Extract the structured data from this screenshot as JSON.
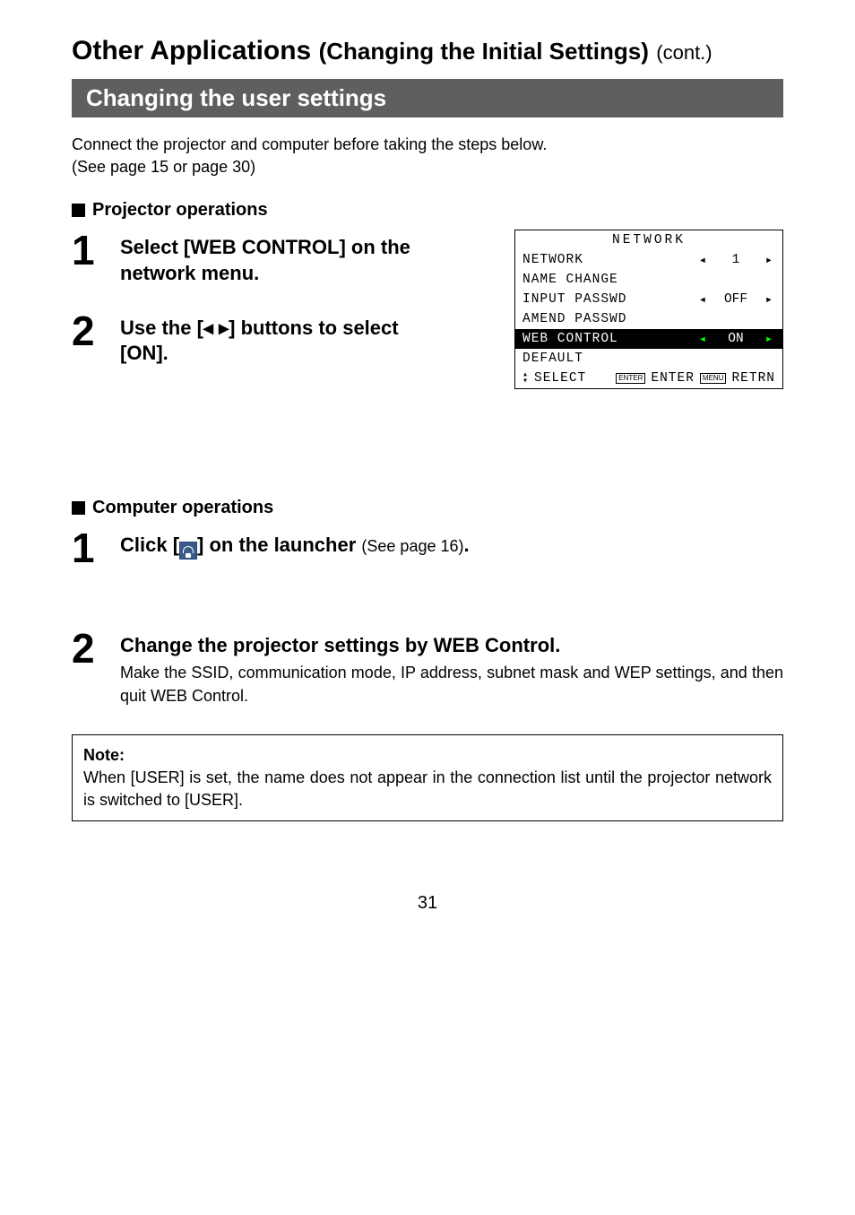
{
  "header": {
    "title_primary": "Other Applications",
    "title_secondary": "(Changing the Initial Settings)",
    "title_suffix": "(cont.)",
    "section_title": "Changing the user settings"
  },
  "intro": {
    "line1": "Connect the projector and computer before taking the steps below.",
    "line2": "(See page 15 or page 30)"
  },
  "projector": {
    "heading": "Projector operations",
    "steps": [
      {
        "num": "1",
        "title_a": "Select [WEB CONTROL] on the",
        "title_b": "network menu."
      },
      {
        "num": "2",
        "title_a": "Use the [",
        "title_b": "] buttons to select",
        "title_c": "[ON]."
      }
    ]
  },
  "menu": {
    "title": "NETWORK",
    "rows": [
      {
        "label": "NETWORK",
        "left_arrow": true,
        "value": "1",
        "right_arrow": true
      },
      {
        "label": "NAME CHANGE"
      },
      {
        "label": "INPUT PASSWD",
        "left_arrow": true,
        "value": "OFF",
        "right_arrow": true
      },
      {
        "label": "AMEND PASSWD"
      },
      {
        "label": "WEB CONTROL",
        "left_arrow": true,
        "value": "ON",
        "right_arrow": true,
        "highlight": true
      },
      {
        "label": "DEFAULT"
      }
    ],
    "footer": {
      "select": "SELECT",
      "enter_badge": "ENTER",
      "enter": "ENTER",
      "menu_badge": "MENU",
      "retrn": "RETRN"
    }
  },
  "computer": {
    "heading": "Computer operations",
    "steps": [
      {
        "num": "1",
        "pre": "Click [",
        "post": "] on the launcher",
        "suffix": "(See page 16)",
        "period": "."
      },
      {
        "num": "2",
        "title": "Change the projector settings by WEB Control.",
        "body": "Make the SSID, communication mode, IP address, subnet mask and WEP settings, and then quit WEB Control."
      }
    ]
  },
  "note": {
    "title": "Note:",
    "body": "When [USER] is set, the name does not appear in the connection list until the projector network is switched to [USER]."
  },
  "page_number": "31"
}
